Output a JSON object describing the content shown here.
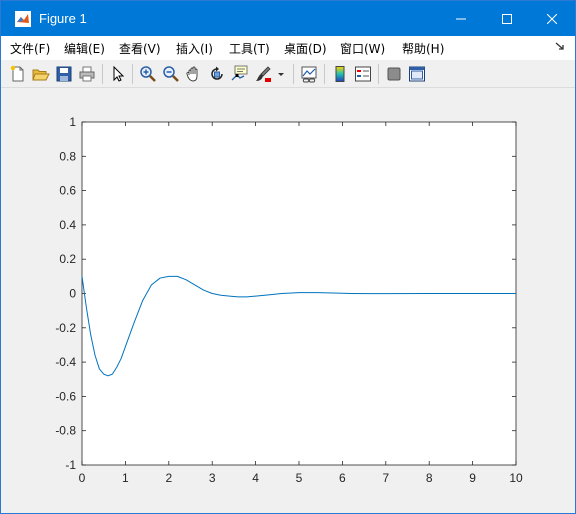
{
  "window": {
    "title": "Figure 1",
    "icon": "matlab-logo-icon",
    "controls": [
      "minimize-icon",
      "maximize-icon",
      "close-icon"
    ],
    "titlebar_color": "#0078d7"
  },
  "menu": {
    "items": [
      {
        "label": "文件(F)",
        "name": "menu-file"
      },
      {
        "label": "编辑(E)",
        "name": "menu-edit"
      },
      {
        "label": "查看(V)",
        "name": "menu-view"
      },
      {
        "label": "插入(I)",
        "name": "menu-insert"
      },
      {
        "label": "工具(T)",
        "name": "menu-tools"
      },
      {
        "label": "桌面(D)",
        "name": "menu-desktop"
      },
      {
        "label": "窗口(W)",
        "name": "menu-window"
      },
      {
        "label": "帮助(H)",
        "name": "menu-help"
      }
    ]
  },
  "toolbar": {
    "icons": [
      "new-figure-icon",
      "open-file-icon",
      "save-icon",
      "print-icon",
      "edit-plot-icon",
      "zoom-in-icon",
      "zoom-out-icon",
      "pan-icon",
      "rotate-3d-icon",
      "data-cursor-icon",
      "brush-icon",
      "brush-dropdown-icon",
      "link-plot-icon",
      "colorbar-icon",
      "legend-icon",
      "hide-plot-tools-icon",
      "show-plot-tools-icon"
    ]
  },
  "chart_data": {
    "type": "line",
    "title": "",
    "xlabel": "",
    "ylabel": "",
    "xlim": [
      0,
      10
    ],
    "ylim": [
      -1,
      1
    ],
    "xticks": [
      0,
      1,
      2,
      3,
      4,
      5,
      6,
      7,
      8,
      9,
      10
    ],
    "yticks": [
      -1,
      -0.8,
      -0.6,
      -0.4,
      -0.2,
      0,
      0.2,
      0.4,
      0.6,
      0.8,
      1
    ],
    "xtick_labels": [
      "0",
      "1",
      "2",
      "3",
      "4",
      "5",
      "6",
      "7",
      "8",
      "9",
      "10"
    ],
    "ytick_labels": [
      "-1",
      "-0.8",
      "-0.6",
      "-0.4",
      "-0.2",
      "0",
      "0.2",
      "0.4",
      "0.6",
      "0.8",
      "1"
    ],
    "grid": false,
    "series": [
      {
        "color": "#0072bd",
        "x": [
          0,
          0.1,
          0.2,
          0.3,
          0.4,
          0.5,
          0.6,
          0.7,
          0.8,
          0.9,
          1.0,
          1.2,
          1.4,
          1.6,
          1.8,
          2.0,
          2.2,
          2.4,
          2.6,
          2.8,
          3.0,
          3.2,
          3.4,
          3.6,
          3.8,
          4.0,
          4.3,
          4.6,
          5.0,
          5.4,
          5.8,
          6.2,
          6.6,
          7.0,
          8.0,
          9.0,
          10.0
        ],
        "y": [
          0.1,
          -0.08,
          -0.24,
          -0.36,
          -0.44,
          -0.47,
          -0.48,
          -0.47,
          -0.43,
          -0.38,
          -0.31,
          -0.17,
          -0.04,
          0.05,
          0.09,
          0.1,
          0.1,
          0.08,
          0.05,
          0.02,
          0.0,
          -0.01,
          -0.015,
          -0.02,
          -0.02,
          -0.015,
          -0.008,
          0.0,
          0.005,
          0.005,
          0.003,
          0.0,
          -0.001,
          -0.001,
          0.0,
          0.0,
          0.0
        ]
      }
    ]
  }
}
